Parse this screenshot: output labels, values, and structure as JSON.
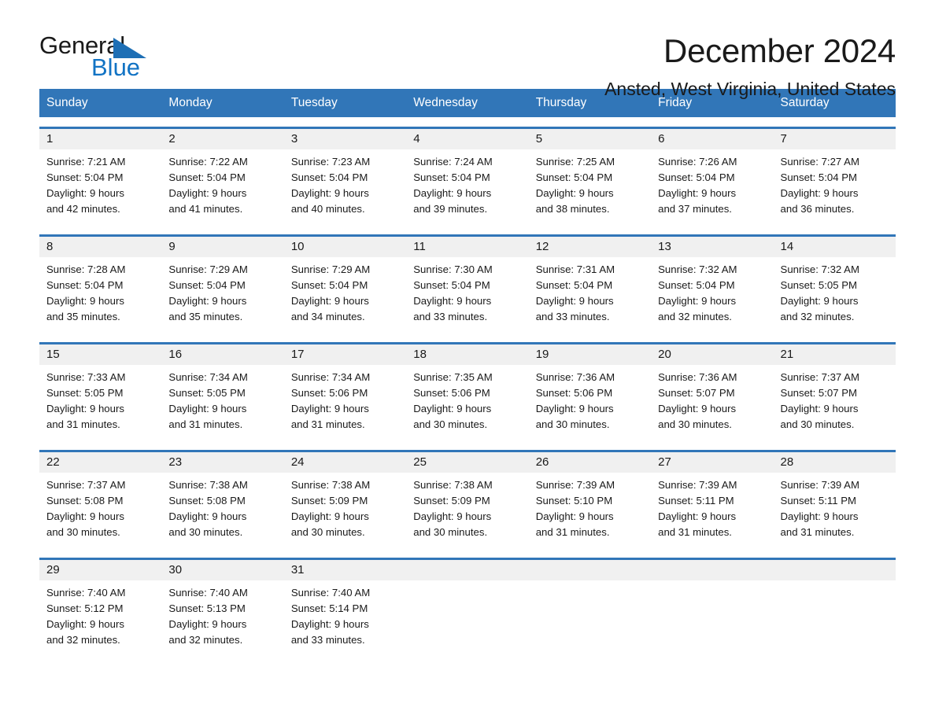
{
  "brand": {
    "name_top": "General",
    "name_bottom": "Blue",
    "accent_color": "#1273c4",
    "triangle_color": "#1e6fb5"
  },
  "header": {
    "title": "December 2024",
    "subtitle": "Ansted, West Virginia, United States"
  },
  "theme": {
    "header_bar_color": "#3176b8",
    "daynum_band_color": "#f0f0f0",
    "text_color": "#1a1a1a"
  },
  "weekdays": [
    "Sunday",
    "Monday",
    "Tuesday",
    "Wednesday",
    "Thursday",
    "Friday",
    "Saturday"
  ],
  "weeks": [
    [
      {
        "day": "1",
        "info": "Sunrise: 7:21 AM\nSunset: 5:04 PM\nDaylight: 9 hours\nand 42 minutes."
      },
      {
        "day": "2",
        "info": "Sunrise: 7:22 AM\nSunset: 5:04 PM\nDaylight: 9 hours\nand 41 minutes."
      },
      {
        "day": "3",
        "info": "Sunrise: 7:23 AM\nSunset: 5:04 PM\nDaylight: 9 hours\nand 40 minutes."
      },
      {
        "day": "4",
        "info": "Sunrise: 7:24 AM\nSunset: 5:04 PM\nDaylight: 9 hours\nand 39 minutes."
      },
      {
        "day": "5",
        "info": "Sunrise: 7:25 AM\nSunset: 5:04 PM\nDaylight: 9 hours\nand 38 minutes."
      },
      {
        "day": "6",
        "info": "Sunrise: 7:26 AM\nSunset: 5:04 PM\nDaylight: 9 hours\nand 37 minutes."
      },
      {
        "day": "7",
        "info": "Sunrise: 7:27 AM\nSunset: 5:04 PM\nDaylight: 9 hours\nand 36 minutes."
      }
    ],
    [
      {
        "day": "8",
        "info": "Sunrise: 7:28 AM\nSunset: 5:04 PM\nDaylight: 9 hours\nand 35 minutes."
      },
      {
        "day": "9",
        "info": "Sunrise: 7:29 AM\nSunset: 5:04 PM\nDaylight: 9 hours\nand 35 minutes."
      },
      {
        "day": "10",
        "info": "Sunrise: 7:29 AM\nSunset: 5:04 PM\nDaylight: 9 hours\nand 34 minutes."
      },
      {
        "day": "11",
        "info": "Sunrise: 7:30 AM\nSunset: 5:04 PM\nDaylight: 9 hours\nand 33 minutes."
      },
      {
        "day": "12",
        "info": "Sunrise: 7:31 AM\nSunset: 5:04 PM\nDaylight: 9 hours\nand 33 minutes."
      },
      {
        "day": "13",
        "info": "Sunrise: 7:32 AM\nSunset: 5:04 PM\nDaylight: 9 hours\nand 32 minutes."
      },
      {
        "day": "14",
        "info": "Sunrise: 7:32 AM\nSunset: 5:05 PM\nDaylight: 9 hours\nand 32 minutes."
      }
    ],
    [
      {
        "day": "15",
        "info": "Sunrise: 7:33 AM\nSunset: 5:05 PM\nDaylight: 9 hours\nand 31 minutes."
      },
      {
        "day": "16",
        "info": "Sunrise: 7:34 AM\nSunset: 5:05 PM\nDaylight: 9 hours\nand 31 minutes."
      },
      {
        "day": "17",
        "info": "Sunrise: 7:34 AM\nSunset: 5:06 PM\nDaylight: 9 hours\nand 31 minutes."
      },
      {
        "day": "18",
        "info": "Sunrise: 7:35 AM\nSunset: 5:06 PM\nDaylight: 9 hours\nand 30 minutes."
      },
      {
        "day": "19",
        "info": "Sunrise: 7:36 AM\nSunset: 5:06 PM\nDaylight: 9 hours\nand 30 minutes."
      },
      {
        "day": "20",
        "info": "Sunrise: 7:36 AM\nSunset: 5:07 PM\nDaylight: 9 hours\nand 30 minutes."
      },
      {
        "day": "21",
        "info": "Sunrise: 7:37 AM\nSunset: 5:07 PM\nDaylight: 9 hours\nand 30 minutes."
      }
    ],
    [
      {
        "day": "22",
        "info": "Sunrise: 7:37 AM\nSunset: 5:08 PM\nDaylight: 9 hours\nand 30 minutes."
      },
      {
        "day": "23",
        "info": "Sunrise: 7:38 AM\nSunset: 5:08 PM\nDaylight: 9 hours\nand 30 minutes."
      },
      {
        "day": "24",
        "info": "Sunrise: 7:38 AM\nSunset: 5:09 PM\nDaylight: 9 hours\nand 30 minutes."
      },
      {
        "day": "25",
        "info": "Sunrise: 7:38 AM\nSunset: 5:09 PM\nDaylight: 9 hours\nand 30 minutes."
      },
      {
        "day": "26",
        "info": "Sunrise: 7:39 AM\nSunset: 5:10 PM\nDaylight: 9 hours\nand 31 minutes."
      },
      {
        "day": "27",
        "info": "Sunrise: 7:39 AM\nSunset: 5:11 PM\nDaylight: 9 hours\nand 31 minutes."
      },
      {
        "day": "28",
        "info": "Sunrise: 7:39 AM\nSunset: 5:11 PM\nDaylight: 9 hours\nand 31 minutes."
      }
    ],
    [
      {
        "day": "29",
        "info": "Sunrise: 7:40 AM\nSunset: 5:12 PM\nDaylight: 9 hours\nand 32 minutes."
      },
      {
        "day": "30",
        "info": "Sunrise: 7:40 AM\nSunset: 5:13 PM\nDaylight: 9 hours\nand 32 minutes."
      },
      {
        "day": "31",
        "info": "Sunrise: 7:40 AM\nSunset: 5:14 PM\nDaylight: 9 hours\nand 33 minutes."
      },
      {
        "day": "",
        "info": ""
      },
      {
        "day": "",
        "info": ""
      },
      {
        "day": "",
        "info": ""
      },
      {
        "day": "",
        "info": ""
      }
    ]
  ]
}
